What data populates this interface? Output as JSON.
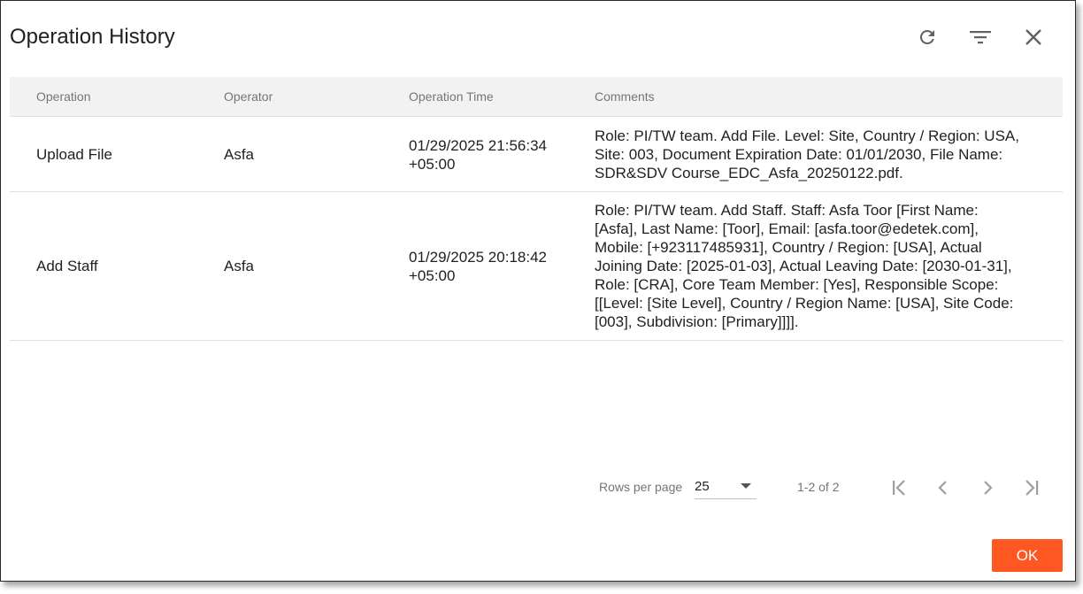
{
  "dialog": {
    "title": "Operation History",
    "icons": [
      "refresh-icon",
      "filter-icon",
      "close-icon"
    ]
  },
  "table": {
    "headers": {
      "operation": "Operation",
      "operator": "Operator",
      "time": "Operation Time",
      "comments": "Comments"
    },
    "rows": [
      {
        "operation": "Upload File",
        "operator": "Asfa",
        "time_line1": "01/29/2025 21:56:34",
        "time_line2": "+05:00",
        "comments": [
          "Role: PI/TW team. Add File. Level: Site, Country / Region: USA,",
          "Site: 003, Document Expiration Date: 01/01/2030, File Name:",
          "SDR&SDV Course_EDC_Asfa_20250122.pdf."
        ]
      },
      {
        "operation": "Add Staff",
        "operator": "Asfa",
        "time_line1": "01/29/2025 20:18:42",
        "time_line2": "+05:00",
        "comments": [
          "Role: PI/TW team. Add Staff. Staff: Asfa Toor [First Name:",
          "[Asfa], Last Name: [Toor], Email: [asfa.toor@edetek.com],",
          "Mobile: [+923117485931], Country / Region: [USA], Actual",
          "Joining Date: [2025-01-03], Actual Leaving Date: [2030-01-31],",
          "Role: [CRA], Core Team Member: [Yes], Responsible Scope:",
          "[[Level: [Site Level], Country / Region Name: [USA], Site Code:",
          "[003], Subdivision: [Primary]]]]."
        ]
      }
    ]
  },
  "pagination": {
    "rows_per_page_label": "Rows per page",
    "rows_per_page_value": "25",
    "range": "1-2 of 2",
    "icons": [
      "first-page-icon",
      "previous-page-icon",
      "next-page-icon",
      "last-page-icon"
    ]
  },
  "footer": {
    "ok_label": "OK"
  },
  "colors": {
    "accent": "#ff5722",
    "header_bg": "#f2f2f2",
    "muted_text": "#757575"
  }
}
